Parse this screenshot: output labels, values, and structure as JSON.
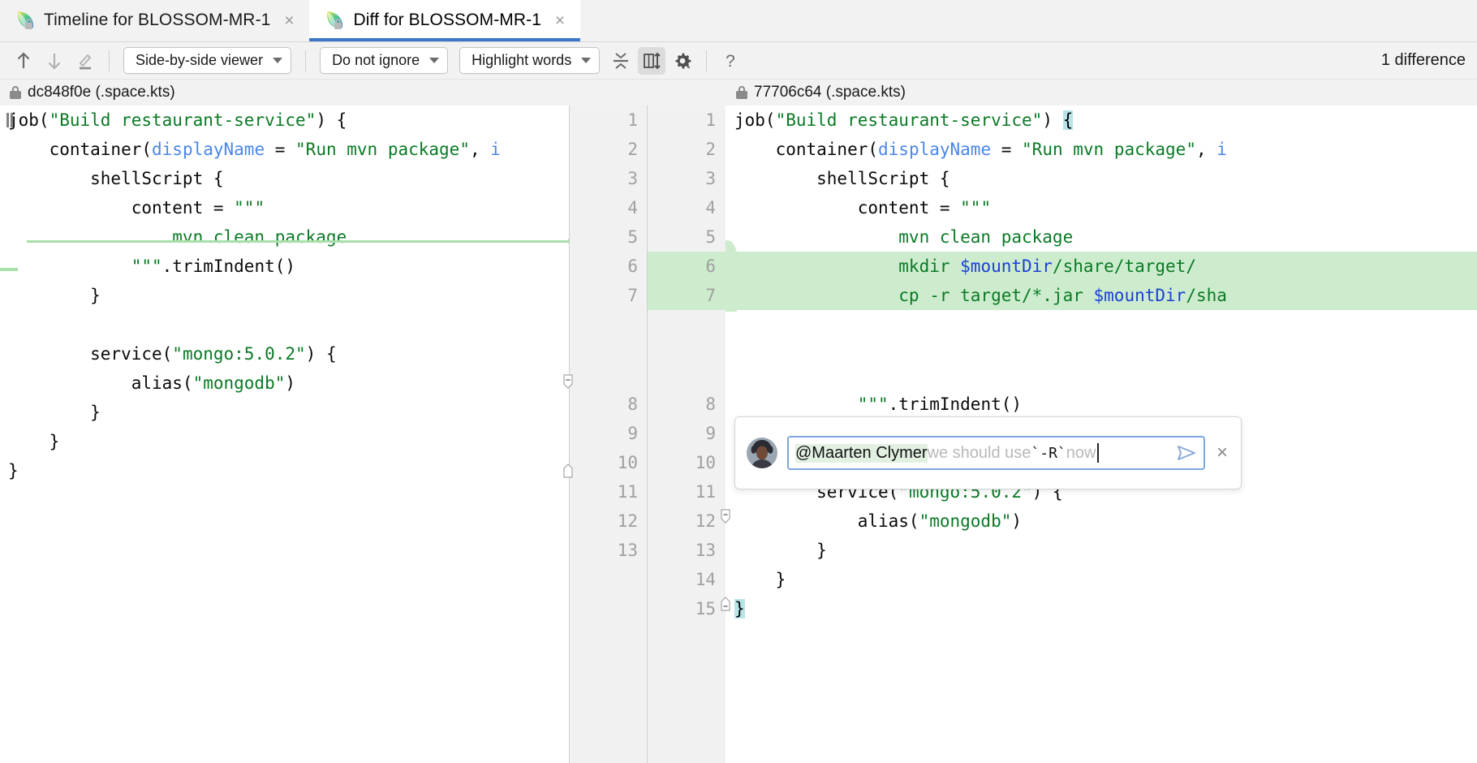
{
  "window": {
    "tabs": [
      {
        "title": "Timeline for BLOSSOM-MR-1",
        "icon": "space-icon",
        "close_label": "×",
        "active": false
      },
      {
        "title": "Diff for BLOSSOM-MR-1",
        "icon": "space-icon",
        "close_label": "×",
        "active": true
      }
    ]
  },
  "toolbar": {
    "previous_difference_icon": "arrow-up-icon",
    "next_difference_icon": "arrow-down-icon",
    "annotate_icon": "pencil-icon",
    "viewer_mode": "Side-by-side viewer",
    "whitespace_mode": "Do not ignore",
    "highlight_mode": "Highlight words",
    "collapse_unchanged_icon": "collapse-unchanged-icon",
    "sync_scroll_icon": "synchronize-scroll-icon",
    "settings_icon": "gear-icon",
    "help_icon": "question-mark-icon",
    "difference_count": "1 difference"
  },
  "file_headers": {
    "left": {
      "lock_icon": "lock-icon",
      "revision": "dc848f0e (.space.kts)"
    },
    "right": {
      "lock_icon": "lock-icon",
      "revision": "77706c64 (.space.kts)"
    }
  },
  "diff": {
    "left_lines": [
      {
        "n": "1",
        "segments": [
          {
            "t": "job(",
            "c": "txt"
          },
          {
            "t": "\"Build restaurant-service\"",
            "c": "str"
          },
          {
            "t": ") {",
            "c": "txt"
          }
        ]
      },
      {
        "n": "2",
        "segments": [
          {
            "t": "    container(",
            "c": "txt"
          },
          {
            "t": "displayName",
            "c": "kw"
          },
          {
            "t": " = ",
            "c": "txt"
          },
          {
            "t": "\"Run mvn package\"",
            "c": "str"
          },
          {
            "t": ", ",
            "c": "txt"
          },
          {
            "t": "i",
            "c": "kw"
          }
        ]
      },
      {
        "n": "3",
        "segments": [
          {
            "t": "        shellScript {",
            "c": "txt"
          }
        ]
      },
      {
        "n": "4",
        "segments": [
          {
            "t": "            content = ",
            "c": "txt"
          },
          {
            "t": "\"\"\"",
            "c": "str"
          }
        ]
      },
      {
        "n": "5",
        "segments": [
          {
            "t": "                mvn clean package",
            "c": "sh"
          }
        ]
      },
      {
        "n": "6",
        "segments": [
          {
            "t": "            ",
            "c": "txt"
          },
          {
            "t": "\"\"\"",
            "c": "str"
          },
          {
            "t": ".trimIndent()",
            "c": "txt"
          }
        ]
      },
      {
        "n": "7",
        "segments": [
          {
            "t": "        }",
            "c": "txt"
          }
        ]
      },
      {
        "n": "8",
        "segments": [
          {
            "t": "",
            "c": "txt"
          }
        ]
      },
      {
        "n": "9",
        "segments": [
          {
            "t": "        service(",
            "c": "txt"
          },
          {
            "t": "\"mongo:5.0.2\"",
            "c": "str"
          },
          {
            "t": ") {",
            "c": "txt"
          }
        ]
      },
      {
        "n": "10",
        "segments": [
          {
            "t": "            alias(",
            "c": "txt"
          },
          {
            "t": "\"mongodb\"",
            "c": "str"
          },
          {
            "t": ")",
            "c": "txt"
          }
        ]
      },
      {
        "n": "11",
        "segments": [
          {
            "t": "        }",
            "c": "txt"
          }
        ]
      },
      {
        "n": "12",
        "segments": [
          {
            "t": "    }",
            "c": "txt"
          }
        ]
      },
      {
        "n": "13",
        "segments": [
          {
            "t": "}",
            "c": "txt"
          }
        ]
      }
    ],
    "right_lines": [
      {
        "n": "1",
        "hl": false,
        "segments": [
          {
            "t": "job(",
            "c": "txt"
          },
          {
            "t": "\"Build restaurant-service\"",
            "c": "str"
          },
          {
            "t": ") ",
            "c": "txt"
          },
          {
            "t": "{",
            "c": "sel"
          }
        ]
      },
      {
        "n": "2",
        "hl": false,
        "segments": [
          {
            "t": "    container(",
            "c": "txt"
          },
          {
            "t": "displayName",
            "c": "kw"
          },
          {
            "t": " = ",
            "c": "txt"
          },
          {
            "t": "\"Run mvn package\"",
            "c": "str"
          },
          {
            "t": ", ",
            "c": "txt"
          },
          {
            "t": "i",
            "c": "kw"
          }
        ]
      },
      {
        "n": "3",
        "hl": false,
        "segments": [
          {
            "t": "        shellScript {",
            "c": "txt"
          }
        ]
      },
      {
        "n": "4",
        "hl": false,
        "segments": [
          {
            "t": "            content = ",
            "c": "txt"
          },
          {
            "t": "\"\"\"",
            "c": "str"
          }
        ]
      },
      {
        "n": "5",
        "hl": false,
        "segments": [
          {
            "t": "                mvn clean package",
            "c": "sh"
          }
        ]
      },
      {
        "n": "6",
        "hl": true,
        "segments": [
          {
            "t": "                mkdir ",
            "c": "sh"
          },
          {
            "t": "$mountDir",
            "c": "var"
          },
          {
            "t": "/share/target/",
            "c": "sh"
          }
        ]
      },
      {
        "n": "7",
        "hl": true,
        "segments": [
          {
            "t": "                cp -r target/*.jar ",
            "c": "sh"
          },
          {
            "t": "$mountDir",
            "c": "var"
          },
          {
            "t": "/sha",
            "c": "sh"
          }
        ]
      },
      {
        "n": "8",
        "hl": false,
        "segments": [
          {
            "t": "            ",
            "c": "txt"
          },
          {
            "t": "\"\"\"",
            "c": "str"
          },
          {
            "t": ".trimIndent()",
            "c": "txt"
          }
        ]
      },
      {
        "n": "9",
        "hl": false,
        "segments": [
          {
            "t": "        }",
            "c": "txt"
          }
        ]
      },
      {
        "n": "10",
        "hl": false,
        "segments": [
          {
            "t": "",
            "c": "txt"
          }
        ]
      },
      {
        "n": "11",
        "hl": false,
        "segments": [
          {
            "t": "        service(",
            "c": "txt"
          },
          {
            "t": "\"mongo:5.0.2\"",
            "c": "str"
          },
          {
            "t": ") {",
            "c": "txt"
          }
        ]
      },
      {
        "n": "12",
        "hl": false,
        "segments": [
          {
            "t": "            alias(",
            "c": "txt"
          },
          {
            "t": "\"mongodb\"",
            "c": "str"
          },
          {
            "t": ")",
            "c": "txt"
          }
        ]
      },
      {
        "n": "13",
        "hl": false,
        "segments": [
          {
            "t": "        }",
            "c": "txt"
          }
        ]
      },
      {
        "n": "14",
        "hl": false,
        "segments": [
          {
            "t": "    }",
            "c": "txt"
          }
        ]
      },
      {
        "n": "15",
        "hl": false,
        "segments": [
          {
            "t": "}",
            "c": "sel"
          }
        ]
      }
    ],
    "added_highlight_color": "#cdeccd",
    "selection_color": "#b7e4e8"
  },
  "comment": {
    "avatar_name": "user-avatar",
    "mention": "@Maarten Clymer",
    "text_before_code": " we should use ",
    "code_snippet": "`-R`",
    "text_after_code": " now ",
    "send_icon": "send-icon",
    "close_label": "×"
  }
}
